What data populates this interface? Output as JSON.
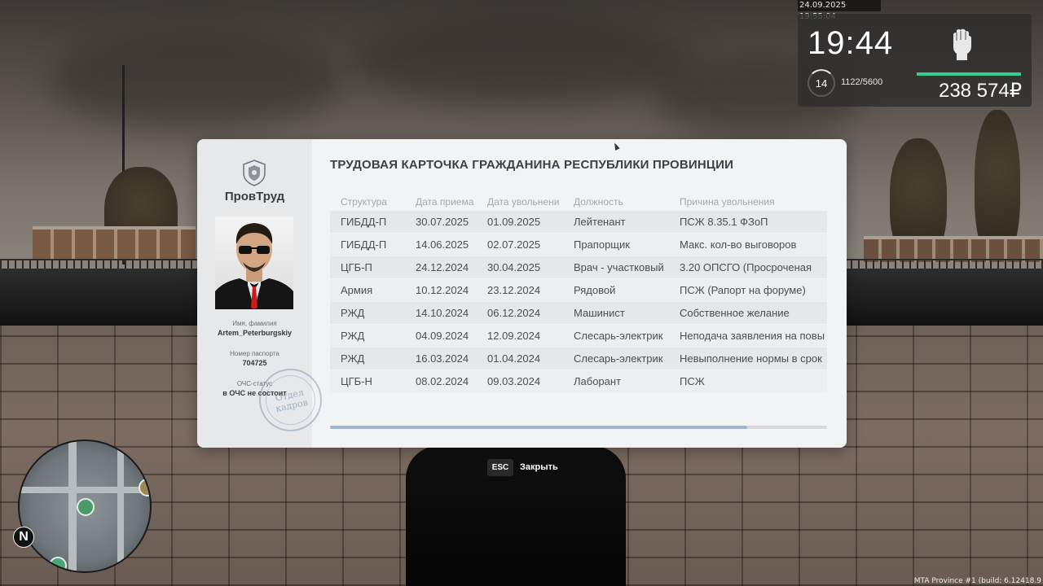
{
  "hud": {
    "datetime": "24.09.2025 19:55:04",
    "time": "19:44",
    "level": "14",
    "xp": "1122/5600",
    "xp_progress": 0.2,
    "money": "238 574₽",
    "accent_color": "#2fd08a"
  },
  "card": {
    "org_name": "ПровТруд",
    "title": "ТРУДОВАЯ КАРТОЧКА ГРАЖДАНИНА РЕСПУБЛИКИ ПРОВИНЦИИ",
    "name_label": "Имя, фамилия",
    "name_value": "Artem_Peterburgskiy",
    "passport_label": "Номер паспорта",
    "passport_value": "704725",
    "status_label": "ОЧС-статус",
    "status_value": "в ОЧС не состоит",
    "stamp_line1": "Отдел",
    "stamp_line2": "кадров",
    "columns": [
      "Структура",
      "Дата приема",
      "Дата увольнени",
      "Должность",
      "Причина увольнения"
    ],
    "rows": [
      [
        "ГИБДД-П",
        "30.07.2025",
        "01.09.2025",
        "Лейтенант",
        "ПСЖ 8.35.1 ФЗоП"
      ],
      [
        "ГИБДД-П",
        "14.06.2025",
        "02.07.2025",
        "Прапорщик",
        "Макс. кол-во выговоров"
      ],
      [
        "ЦГБ-П",
        "24.12.2024",
        "30.04.2025",
        "Врач - участковый",
        "3.20 ОПСГО (Просроченая"
      ],
      [
        "Армия",
        "10.12.2024",
        "23.12.2024",
        "Рядовой",
        "ПСЖ (Рапорт на форуме)"
      ],
      [
        "РЖД",
        "14.10.2024",
        "06.12.2024",
        "Машинист",
        "Собственное желание"
      ],
      [
        "РЖД",
        "04.09.2024",
        "12.09.2024",
        "Слесарь-электрик",
        "Неподача заявления на повы"
      ],
      [
        "РЖД",
        "16.03.2024",
        "01.04.2024",
        "Слесарь-электрик",
        "Невыполнение нормы в срок"
      ],
      [
        "ЦГБ-Н",
        "08.02.2024",
        "09.03.2024",
        "Лаборант",
        "ПСЖ"
      ]
    ],
    "scroll_progress": 0.84
  },
  "close": {
    "key": "ESC",
    "label": "Закрыть"
  },
  "minimap": {
    "north": "N"
  },
  "build_info": "MTA Province #1 (build: 6.12418.9"
}
